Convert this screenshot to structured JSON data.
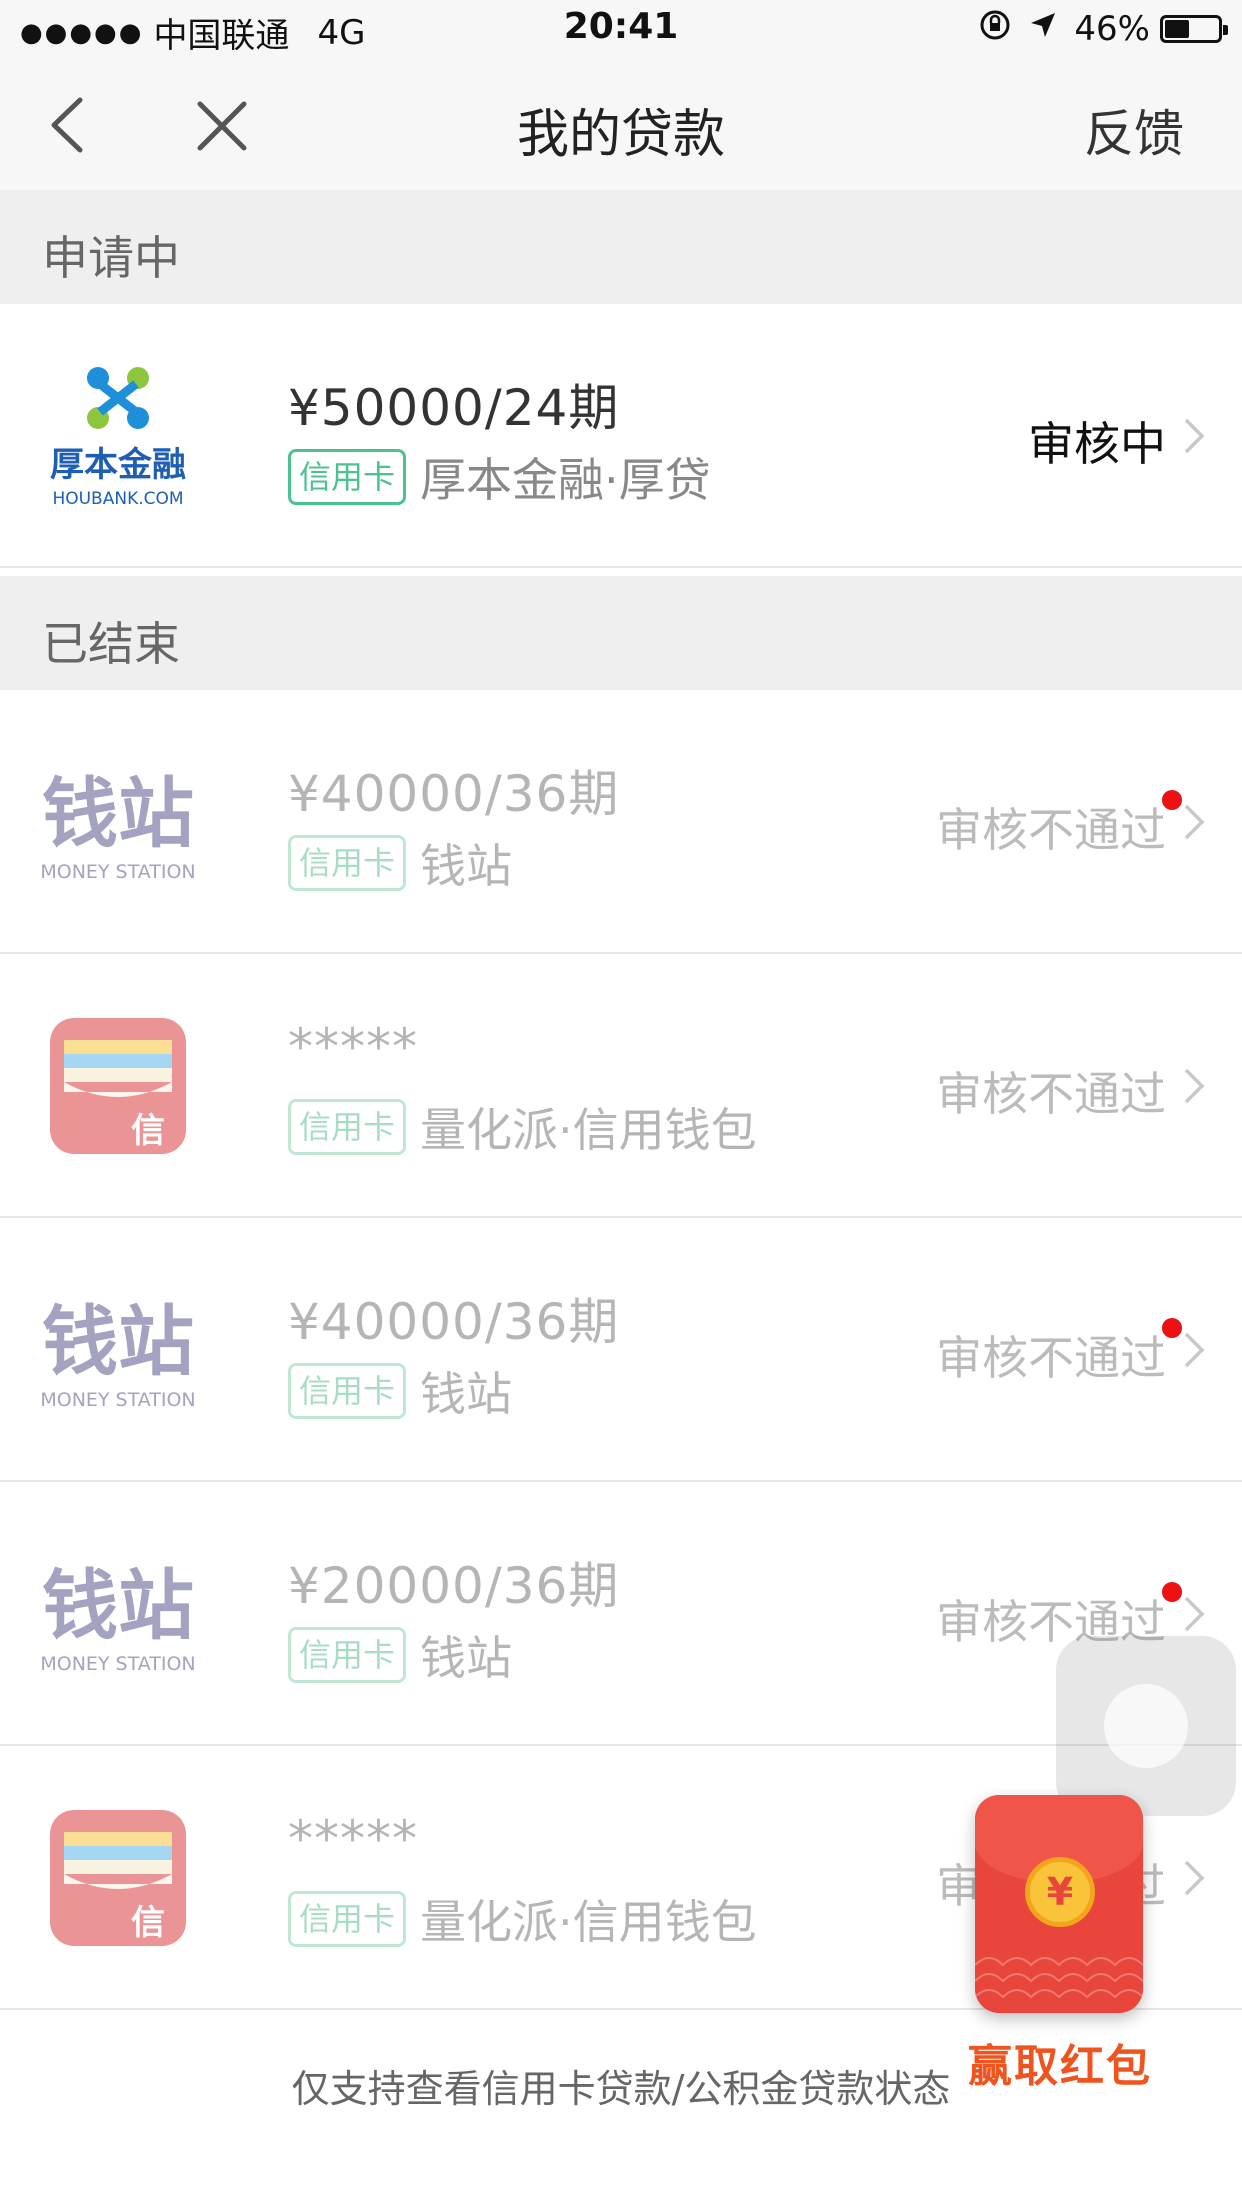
{
  "status_bar": {
    "signal_dots": "●●●●●",
    "carrier": "中国联通",
    "network": "4G",
    "time": "20:41",
    "battery": "46%",
    "battery_level": 0.46
  },
  "nav": {
    "title": "我的贷款",
    "feedback": "反馈"
  },
  "sections": {
    "applying": "申请中",
    "ended": "已结束"
  },
  "loans": [
    {
      "amount": "¥50000/24期",
      "tag": "信用卡",
      "name": "厚本金融·厚贷",
      "status": "审核中",
      "logo": "houbank-logo",
      "logo_text": "厚本金融",
      "logo_subtext": "HOUBANK.COM",
      "unread": false
    },
    {
      "amount": "¥40000/36期",
      "tag": "信用卡",
      "name": "钱站",
      "status": "审核不通过",
      "logo": "money-station-logo",
      "logo_text": "钱站",
      "logo_subtext": "MONEY STATION",
      "unread": true
    },
    {
      "amount": "*****",
      "tag": "信用卡",
      "name": "量化派·信用钱包",
      "status": "审核不通过",
      "logo": "credit-wallet-logo",
      "logo_text": "信",
      "unread": false
    },
    {
      "amount": "¥40000/36期",
      "tag": "信用卡",
      "name": "钱站",
      "status": "审核不通过",
      "logo": "money-station-logo",
      "logo_text": "钱站",
      "logo_subtext": "MONEY STATION",
      "unread": true
    },
    {
      "amount": "¥20000/36期",
      "tag": "信用卡",
      "name": "钱站",
      "status": "审核不通过",
      "logo": "money-station-logo",
      "logo_text": "钱站",
      "logo_subtext": "MONEY STATION",
      "unread": true
    },
    {
      "amount": "*****",
      "tag": "信用卡",
      "name": "量化派·信用钱包",
      "status": "审核不通过",
      "logo": "credit-wallet-logo",
      "logo_text": "信",
      "unread": false
    }
  ],
  "footer": "仅支持查看信用卡贷款/公积金贷款状态",
  "red_packet": {
    "coin": "¥",
    "label": "赢取红包"
  },
  "colors": {
    "tag_green": "#4cc28f",
    "unread_red": "#ee1111",
    "red_packet": "#e8453c",
    "red_packet_label": "#f0541e"
  }
}
